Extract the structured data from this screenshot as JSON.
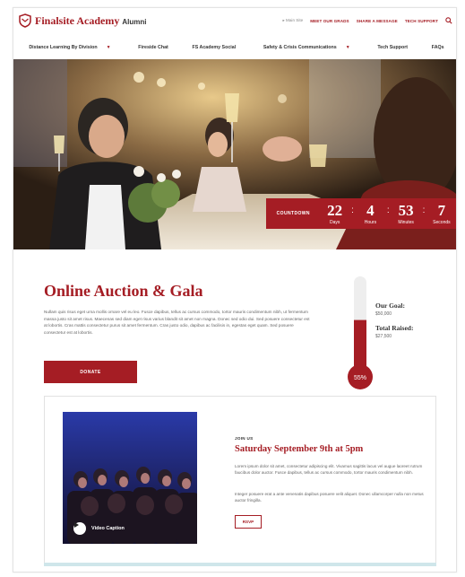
{
  "header": {
    "logo_name": "Finalsite Academy",
    "logo_suffix": "Alumni",
    "main_site_label": "Main Site",
    "util_links": [
      "MEET OUR GRADS",
      "SHARE A MESSAGE",
      "TECH SUPPORT"
    ],
    "search_icon": "search-icon"
  },
  "nav": {
    "items": [
      "Distance Learning By Division",
      "Fireside Chat",
      "FS Academy Social",
      "Safety & Crisis Communications",
      "Tech Support",
      "FAQs"
    ]
  },
  "countdown": {
    "label": "COUNTDOWN",
    "days": "22",
    "days_label": "Days",
    "hours": "4",
    "hours_label": "Hours",
    "minutes": "53",
    "minutes_label": "Minutes",
    "seconds": "7",
    "seconds_label": "Seconds"
  },
  "auction": {
    "title": "Online Auction & Gala",
    "body": "Nullam quis risus eget urna mollis ornare vel eu leo. Fusce dapibus, tellus ac cursus commodo, tortor mauris condimentum nibh, ut fermentum massa justo sit amet risus. Maecenas sed diam eget risus varius blandit sit amet non magna. Donec sed odio dui. Sed posuere consectetur est at lobortis. Cras mattis consectetur purus sit amet fermentum. Cras justo odio, dapibus ac facilisis in, egestas eget quam. Sed posuere consectetur est at lobortis.",
    "donate_label": "DONATE",
    "progress_percent": 55,
    "progress_label": "55%",
    "goal_label": "Our Goal:",
    "goal_value": "$50,000",
    "raised_label": "Total Raised:",
    "raised_value": "$27,500"
  },
  "event": {
    "video_caption": "Video Caption",
    "kicker": "JOIN US",
    "title": "Saturday September 9th at 5pm",
    "body1": "Lorem ipsum dolor sit amet, consectetur adipiscing elit. Vivamus sagittis lacus vel augue laoreet rutrum faucibus dolor auctor. Fusce dapibus, tellus ac cursus commodo, tortor mauris condimentum nibh.",
    "body2": "Integer posuere erat a ante venenatis dapibus posuere velit aliquet. Donec ullamcorper nulla non metus auctor fringilla.",
    "rsvp_label": "RSVP"
  },
  "colors": {
    "brand": "#a51d24",
    "accent_strip": "#cfe6ea"
  }
}
